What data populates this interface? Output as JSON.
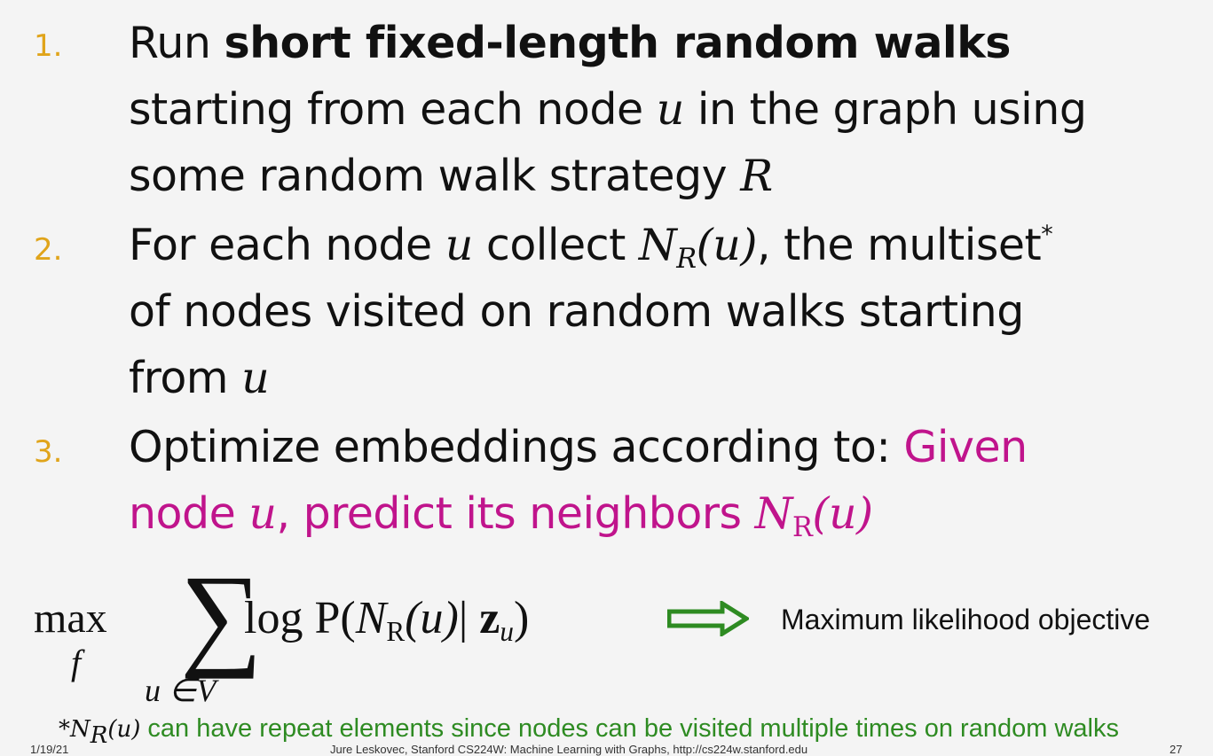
{
  "items": [
    {
      "number": "1.",
      "lines": [
        {
          "pre": "Run ",
          "bold": "short fixed-length random walks"
        },
        {
          "text": "starting from each node ",
          "math": "u",
          "post": " in the graph using"
        },
        {
          "text": "some random walk strategy ",
          "math": "R"
        }
      ]
    },
    {
      "number": "2.",
      "lines": [
        {
          "text": "For each node ",
          "math": "u",
          "mid": " collect ",
          "math2": "N",
          "math2_sub": "R",
          "math2_arg": "(u)",
          "post": ", the multiset",
          "sup": "*"
        },
        {
          "text": "of nodes visited on random walks starting"
        },
        {
          "text": "from ",
          "math": "u"
        }
      ]
    },
    {
      "number": "3.",
      "lines": [
        {
          "text": "Optimize embeddings according to: ",
          "highlight": "Given"
        },
        {
          "highlight_pre": "node ",
          "math": "u",
          "highlight_mid": ", predict its neighbors ",
          "math2": "N",
          "math2_sub": "R",
          "math2_arg": "(u)"
        }
      ]
    }
  ],
  "formula": {
    "max": "max",
    "max_sub": "f",
    "sum": "∑",
    "sum_sub": "u ∈V",
    "log_p": "log P(",
    "n": "N",
    "n_sub": "R",
    "n_arg": "(u)",
    "bar": "| ",
    "z": "z",
    "z_sub": "u",
    "close": ")"
  },
  "objective": "Maximum likelihood objective",
  "footnote": {
    "star": "*",
    "math": "N",
    "math_sub": "R",
    "math_arg": "(u)",
    "text": " can have repeat elements since nodes can be visited multiple times on random walks"
  },
  "footer": {
    "date": "1/19/21",
    "credit": "Jure Leskovec, Stanford CS224W: Machine Learning with Graphs, http://cs224w.stanford.edu",
    "page": "27"
  },
  "colors": {
    "number": "#e0a41a",
    "highlight": "#c0148c",
    "arrow": "#2e8b22",
    "footnote": "#2e8b22"
  }
}
